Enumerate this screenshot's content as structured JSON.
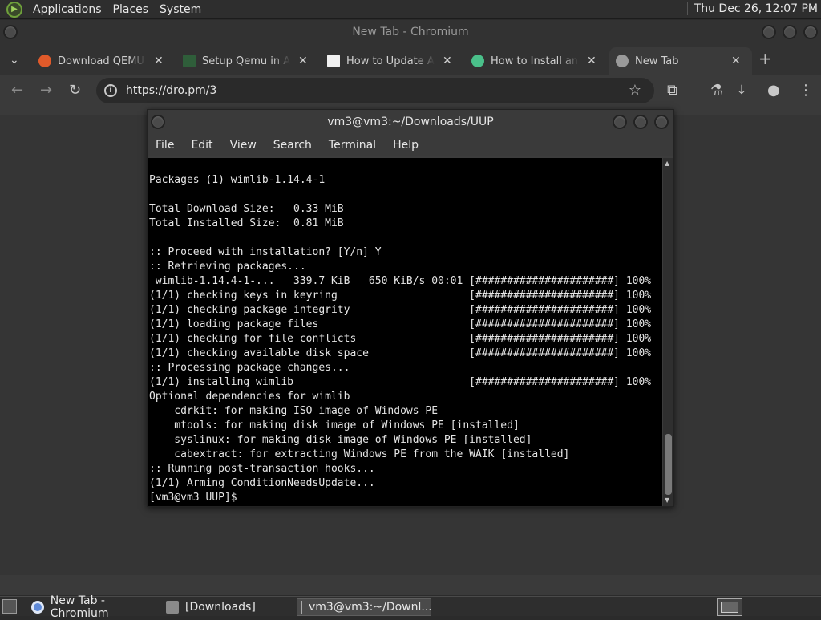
{
  "top_panel": {
    "menus": [
      "Applications",
      "Places",
      "System"
    ],
    "clock": "Thu Dec 26, 12:07 PM"
  },
  "browser": {
    "window_title": "New Tab - Chromium",
    "tabs": [
      {
        "title": "Download QEMU - QEMU",
        "favicon_color": "#e05a2a"
      },
      {
        "title": "Setup Qemu in Arch Linux",
        "favicon_color": "#2f5e3a"
      },
      {
        "title": "How to Update Arch Linux",
        "favicon_color": "#f0f0f0"
      },
      {
        "title": "How to Install and Use",
        "favicon_color": "#4ac08a"
      },
      {
        "title": "New Tab",
        "favicon_color": "#9a9a9a"
      }
    ],
    "url": "https://dro.pm/3"
  },
  "terminal": {
    "title": "vm3@vm3:~/Downloads/UUP",
    "menu": [
      "File",
      "Edit",
      "View",
      "Search",
      "Terminal",
      "Help"
    ],
    "lines": [
      "Packages (1) wimlib-1.14.4-1",
      "",
      "Total Download Size:   0.33 MiB",
      "Total Installed Size:  0.81 MiB",
      "",
      ":: Proceed with installation? [Y/n] Y",
      ":: Retrieving packages...",
      " wimlib-1.14.4-1-...   339.7 KiB   650 KiB/s 00:01 [######################] 100%",
      "(1/1) checking keys in keyring                     [######################] 100%",
      "(1/1) checking package integrity                   [######################] 100%",
      "(1/1) loading package files                        [######################] 100%",
      "(1/1) checking for file conflicts                  [######################] 100%",
      "(1/1) checking available disk space                [######################] 100%",
      ":: Processing package changes...",
      "(1/1) installing wimlib                            [######################] 100%",
      "Optional dependencies for wimlib",
      "    cdrkit: for making ISO image of Windows PE",
      "    mtools: for making disk image of Windows PE [installed]",
      "    syslinux: for making disk image of Windows PE [installed]",
      "    cabextract: for extracting Windows PE from the WAIK [installed]",
      ":: Running post-transaction hooks...",
      "(1/1) Arming ConditionNeedsUpdate...",
      "[vm3@vm3 UUP]$ "
    ]
  },
  "taskbar": {
    "items": [
      {
        "label": "New Tab - Chromium"
      },
      {
        "label": "[Downloads]"
      },
      {
        "label": "vm3@vm3:~/Downl..."
      }
    ]
  }
}
